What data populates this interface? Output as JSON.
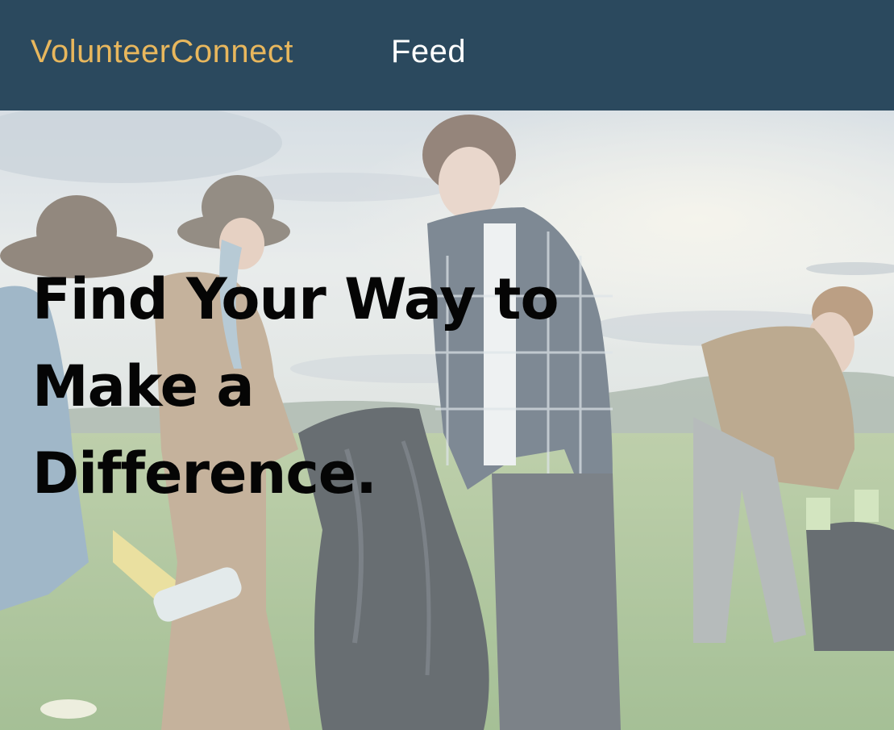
{
  "header": {
    "brand": "VolunteerConnect",
    "nav_items": [
      {
        "label": "Feed"
      }
    ]
  },
  "hero": {
    "title_lines": [
      "Find Your Way to",
      "Make a",
      "Difference."
    ],
    "image_icon": "volunteers-cleanup-photo"
  },
  "colors": {
    "nav_background": "#2b495e",
    "brand": "#e8b75d",
    "nav_link": "#ffffff",
    "title": "#050505"
  }
}
